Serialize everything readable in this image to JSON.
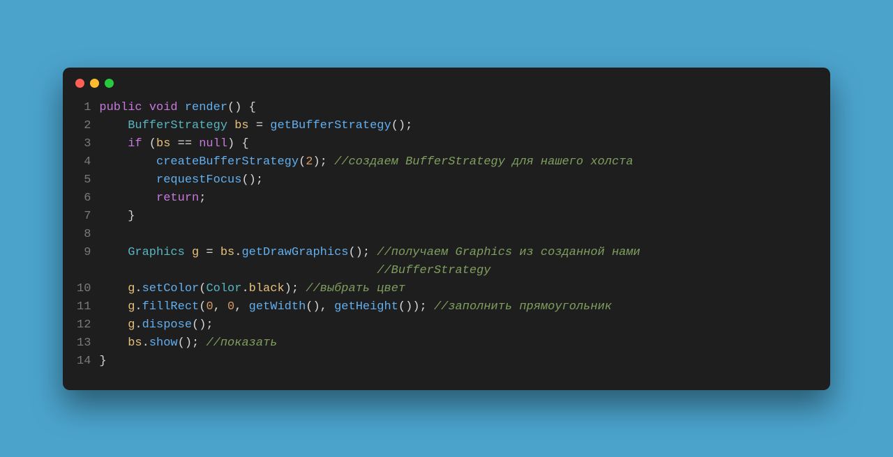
{
  "traffic": {
    "red": "#ff5f56",
    "yellow": "#ffbd2e",
    "green": "#27c93f"
  },
  "code": {
    "lines": [
      {
        "n": "1",
        "tokens": [
          {
            "t": "public",
            "c": "kw"
          },
          {
            "t": " ",
            "c": "pun"
          },
          {
            "t": "void",
            "c": "kw"
          },
          {
            "t": " ",
            "c": "pun"
          },
          {
            "t": "render",
            "c": "fn"
          },
          {
            "t": "() {",
            "c": "pun"
          }
        ]
      },
      {
        "n": "2",
        "tokens": [
          {
            "t": "    ",
            "c": "pun"
          },
          {
            "t": "BufferStrategy",
            "c": "type"
          },
          {
            "t": " ",
            "c": "pun"
          },
          {
            "t": "bs",
            "c": "id"
          },
          {
            "t": " = ",
            "c": "pun"
          },
          {
            "t": "getBufferStrategy",
            "c": "fn"
          },
          {
            "t": "();",
            "c": "pun"
          }
        ]
      },
      {
        "n": "3",
        "tokens": [
          {
            "t": "    ",
            "c": "pun"
          },
          {
            "t": "if",
            "c": "kw"
          },
          {
            "t": " (",
            "c": "pun"
          },
          {
            "t": "bs",
            "c": "id"
          },
          {
            "t": " == ",
            "c": "pun"
          },
          {
            "t": "null",
            "c": "kw"
          },
          {
            "t": ") {",
            "c": "pun"
          }
        ]
      },
      {
        "n": "4",
        "tokens": [
          {
            "t": "        ",
            "c": "pun"
          },
          {
            "t": "createBufferStrategy",
            "c": "fn"
          },
          {
            "t": "(",
            "c": "pun"
          },
          {
            "t": "2",
            "c": "num"
          },
          {
            "t": "); ",
            "c": "pun"
          },
          {
            "t": "//создаем BufferStrategy для нашего холста",
            "c": "cmt"
          }
        ]
      },
      {
        "n": "5",
        "tokens": [
          {
            "t": "        ",
            "c": "pun"
          },
          {
            "t": "requestFocus",
            "c": "fn"
          },
          {
            "t": "();",
            "c": "pun"
          }
        ]
      },
      {
        "n": "6",
        "tokens": [
          {
            "t": "        ",
            "c": "pun"
          },
          {
            "t": "return",
            "c": "kw"
          },
          {
            "t": ";",
            "c": "pun"
          }
        ]
      },
      {
        "n": "7",
        "tokens": [
          {
            "t": "    }",
            "c": "pun"
          }
        ]
      },
      {
        "n": "8",
        "tokens": [
          {
            "t": "",
            "c": "pun"
          }
        ]
      },
      {
        "n": "9",
        "tokens": [
          {
            "t": "    ",
            "c": "pun"
          },
          {
            "t": "Graphics",
            "c": "type"
          },
          {
            "t": " ",
            "c": "pun"
          },
          {
            "t": "g",
            "c": "id"
          },
          {
            "t": " = ",
            "c": "pun"
          },
          {
            "t": "bs",
            "c": "id"
          },
          {
            "t": ".",
            "c": "pun"
          },
          {
            "t": "getDrawGraphics",
            "c": "fn"
          },
          {
            "t": "(); ",
            "c": "pun"
          },
          {
            "t": "//получаем Graphics из созданной нами",
            "c": "cmt"
          }
        ]
      },
      {
        "n": "",
        "tokens": [
          {
            "t": "                                       ",
            "c": "pun"
          },
          {
            "t": "//BufferStrategy",
            "c": "cmt"
          }
        ]
      },
      {
        "n": "10",
        "tokens": [
          {
            "t": "    ",
            "c": "pun"
          },
          {
            "t": "g",
            "c": "id"
          },
          {
            "t": ".",
            "c": "pun"
          },
          {
            "t": "setColor",
            "c": "fn"
          },
          {
            "t": "(",
            "c": "pun"
          },
          {
            "t": "Color",
            "c": "type"
          },
          {
            "t": ".",
            "c": "pun"
          },
          {
            "t": "black",
            "c": "id"
          },
          {
            "t": "); ",
            "c": "pun"
          },
          {
            "t": "//выбрать цвет",
            "c": "cmt"
          }
        ]
      },
      {
        "n": "11",
        "tokens": [
          {
            "t": "    ",
            "c": "pun"
          },
          {
            "t": "g",
            "c": "id"
          },
          {
            "t": ".",
            "c": "pun"
          },
          {
            "t": "fillRect",
            "c": "fn"
          },
          {
            "t": "(",
            "c": "pun"
          },
          {
            "t": "0",
            "c": "num"
          },
          {
            "t": ", ",
            "c": "pun"
          },
          {
            "t": "0",
            "c": "num"
          },
          {
            "t": ", ",
            "c": "pun"
          },
          {
            "t": "getWidth",
            "c": "fn"
          },
          {
            "t": "(), ",
            "c": "pun"
          },
          {
            "t": "getHeight",
            "c": "fn"
          },
          {
            "t": "()); ",
            "c": "pun"
          },
          {
            "t": "//заполнить прямоугольник",
            "c": "cmt"
          }
        ]
      },
      {
        "n": "12",
        "tokens": [
          {
            "t": "    ",
            "c": "pun"
          },
          {
            "t": "g",
            "c": "id"
          },
          {
            "t": ".",
            "c": "pun"
          },
          {
            "t": "dispose",
            "c": "fn"
          },
          {
            "t": "();",
            "c": "pun"
          }
        ]
      },
      {
        "n": "13",
        "tokens": [
          {
            "t": "    ",
            "c": "pun"
          },
          {
            "t": "bs",
            "c": "id"
          },
          {
            "t": ".",
            "c": "pun"
          },
          {
            "t": "show",
            "c": "fn"
          },
          {
            "t": "(); ",
            "c": "pun"
          },
          {
            "t": "//показать",
            "c": "cmt"
          }
        ]
      },
      {
        "n": "14",
        "tokens": [
          {
            "t": "}",
            "c": "pun"
          }
        ]
      }
    ]
  }
}
